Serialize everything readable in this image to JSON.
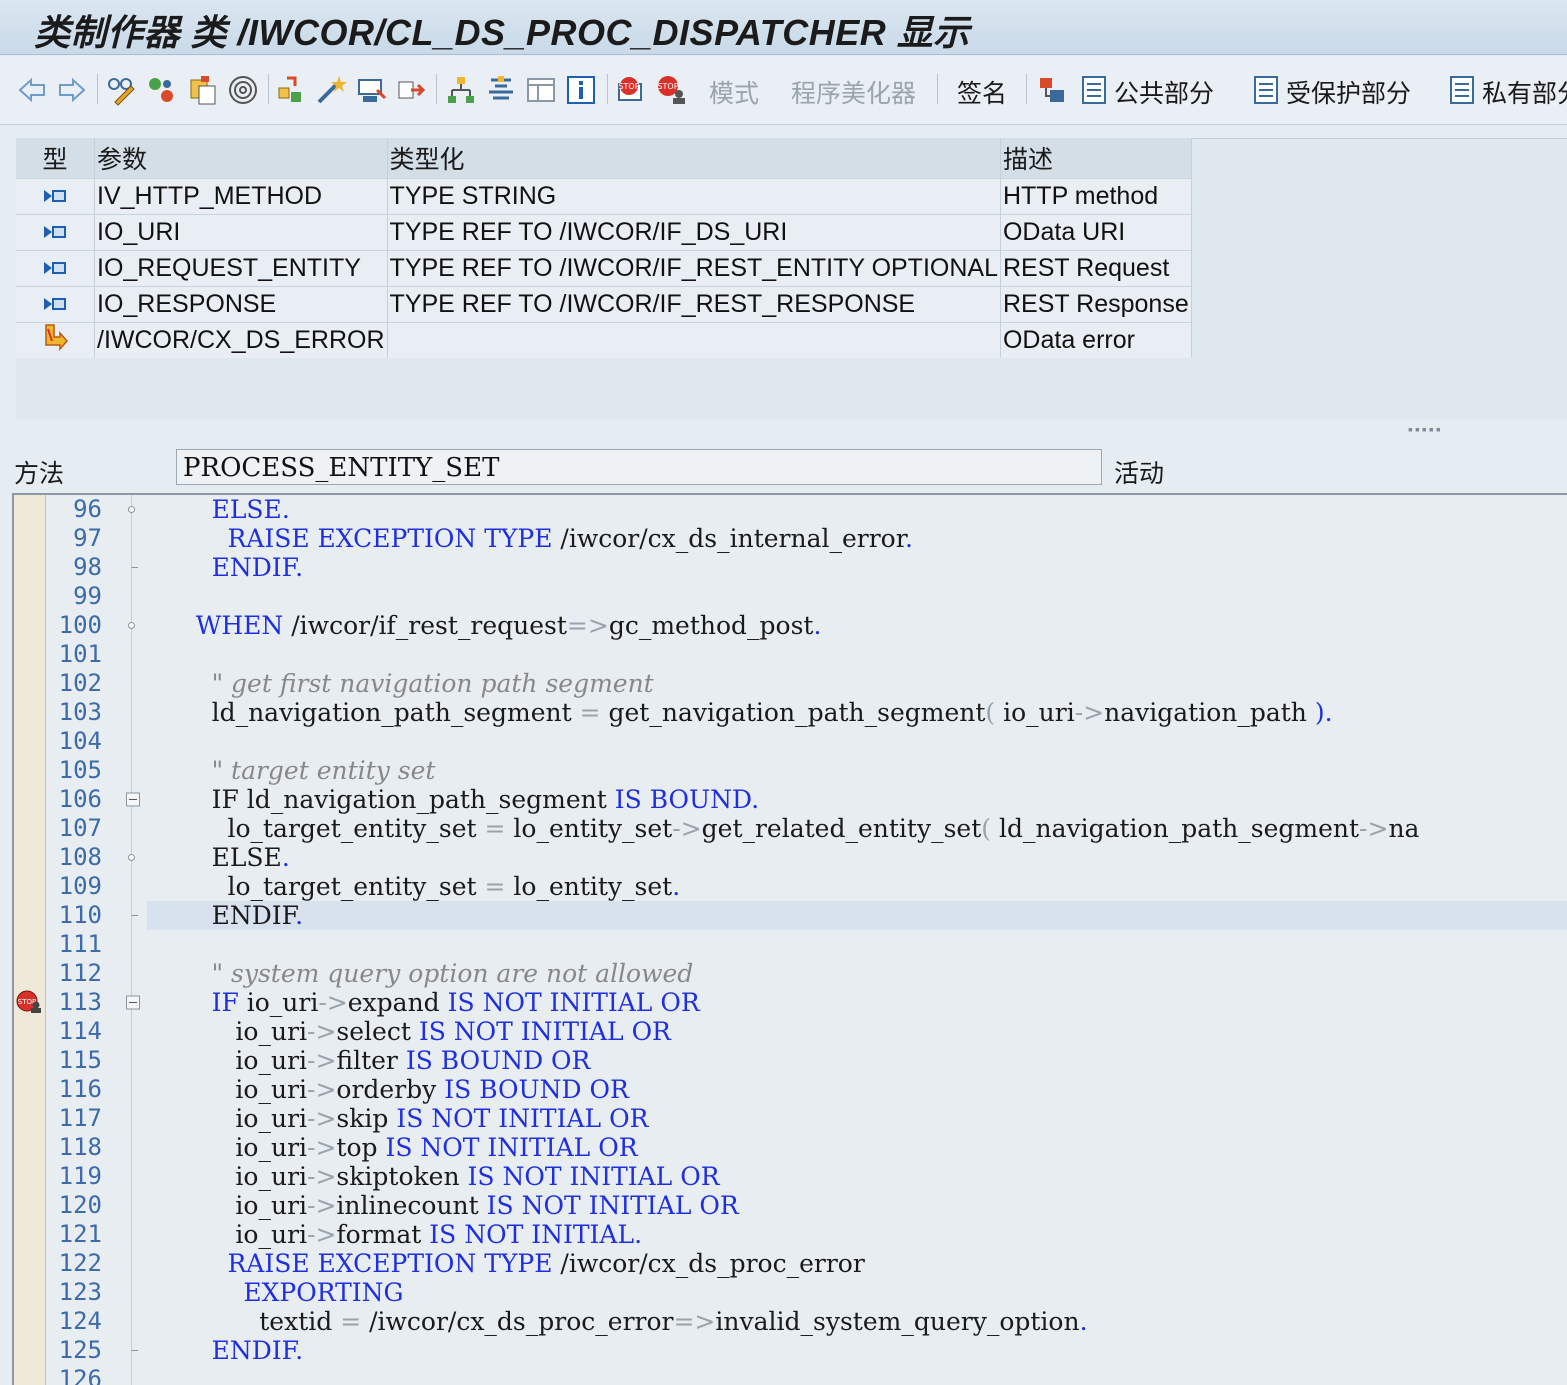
{
  "window": {
    "title": "类制作器 类 /IWCOR/CL_DS_PROC_DISPATCHER 显示"
  },
  "toolbar": {
    "back_icon": "arrow-left-icon",
    "forward_icon": "arrow-right-icon",
    "buttons_text": {
      "mode": "模式",
      "pretty_printer": "程序美化器",
      "signature": "签名",
      "public_section": "公共部分",
      "protected_section": "受保护部分",
      "private_section": "私有部分"
    }
  },
  "params": {
    "headers": {
      "type": "型",
      "param": "参数",
      "typing": "类型化",
      "desc": "描述"
    },
    "rows": [
      {
        "icon": "importing-param-icon",
        "param": "IV_HTTP_METHOD",
        "typing": "TYPE STRING",
        "desc": "HTTP method"
      },
      {
        "icon": "importing-param-icon",
        "param": "IO_URI",
        "typing": "TYPE REF TO /IWCOR/IF_DS_URI",
        "desc": "OData URI"
      },
      {
        "icon": "importing-param-icon",
        "param": "IO_REQUEST_ENTITY",
        "typing": "TYPE REF TO /IWCOR/IF_REST_ENTITY OPTIONAL",
        "desc": "REST Request"
      },
      {
        "icon": "importing-param-icon",
        "param": "IO_RESPONSE",
        "typing": "TYPE REF TO /IWCOR/IF_REST_RESPONSE",
        "desc": "REST Response"
      },
      {
        "icon": "exception-icon",
        "param": "/IWCOR/CX_DS_ERROR",
        "typing": "",
        "desc": "OData error"
      }
    ]
  },
  "method": {
    "label": "方法",
    "name": "PROCESS_ENTITY_SET",
    "status": "活动"
  },
  "colors": {
    "keyword": "#1f2fe0",
    "comment": "#888888",
    "line_number": "#3d6aa9",
    "current_line": "#d7e2ee"
  },
  "code": {
    "current_line": 110,
    "breakpoint_line": 113,
    "lines": [
      {
        "n": "96",
        "fold": "dot",
        "html": "        <span class=\"kw\">ELSE</span><span class=\"pu\">.</span>"
      },
      {
        "n": "97",
        "fold": "",
        "html": "          <span class=\"kw\">RAISE EXCEPTION TYPE</span> /iwcor/cx_ds_internal_error<span class=\"pu\">.</span>"
      },
      {
        "n": "98",
        "fold": "end",
        "html": "        <span class=\"kw\">ENDIF</span><span class=\"pu\">.</span>"
      },
      {
        "n": "99",
        "fold": "",
        "html": ""
      },
      {
        "n": "100",
        "fold": "dot",
        "html": "      <span class=\"kw\">WHEN</span> /iwcor/if_rest_request<span class=\"op\">=&gt;</span>gc_method_post<span class=\"pu\">.</span>"
      },
      {
        "n": "101",
        "fold": "",
        "html": ""
      },
      {
        "n": "102",
        "fold": "",
        "html": "        <span class=\"cm\">\" get first navigation path segment</span>"
      },
      {
        "n": "103",
        "fold": "",
        "html": "        ld_navigation_path_segment <span class=\"op\">=</span> get_navigation_path_segment<span class=\"op\">(</span> io_uri<span class=\"op\">-&gt;</span>navigation_path <span class=\"pu\">).</span>"
      },
      {
        "n": "104",
        "fold": "",
        "html": ""
      },
      {
        "n": "105",
        "fold": "",
        "html": "        <span class=\"cm\">\" target entity set</span>"
      },
      {
        "n": "106",
        "fold": "box",
        "html": "        IF ld_navigation_path_segment <span class=\"kw\">IS BOUND</span><span class=\"pu\">.</span>"
      },
      {
        "n": "107",
        "fold": "",
        "html": "          lo_target_entity_set <span class=\"op\">=</span> lo_entity_set<span class=\"op\">-&gt;</span>get_related_entity_set<span class=\"op\">(</span> ld_navigation_path_segment<span class=\"op\">-&gt;</span>na"
      },
      {
        "n": "108",
        "fold": "dot",
        "html": "        ELSE<span class=\"pu\">.</span>"
      },
      {
        "n": "109",
        "fold": "",
        "html": "          lo_target_entity_set <span class=\"op\">=</span> lo_entity_set<span class=\"pu\">.</span>"
      },
      {
        "n": "110",
        "fold": "end",
        "html": "        ENDIF<span class=\"pu\">.</span>"
      },
      {
        "n": "111",
        "fold": "",
        "html": ""
      },
      {
        "n": "112",
        "fold": "",
        "html": "        <span class=\"cm\">\" system query option are not allowed</span>"
      },
      {
        "n": "113",
        "fold": "box",
        "html": "        <span class=\"kw\">IF</span> io_uri<span class=\"op\">-&gt;</span>expand <span class=\"kw\">IS NOT INITIAL OR</span>"
      },
      {
        "n": "114",
        "fold": "",
        "html": "           io_uri<span class=\"op\">-&gt;</span>select <span class=\"kw\">IS NOT INITIAL OR</span>"
      },
      {
        "n": "115",
        "fold": "",
        "html": "           io_uri<span class=\"op\">-&gt;</span>filter <span class=\"kw\">IS BOUND OR</span>"
      },
      {
        "n": "116",
        "fold": "",
        "html": "           io_uri<span class=\"op\">-&gt;</span>orderby <span class=\"kw\">IS BOUND OR</span>"
      },
      {
        "n": "117",
        "fold": "",
        "html": "           io_uri<span class=\"op\">-&gt;</span>skip <span class=\"kw\">IS NOT INITIAL OR</span>"
      },
      {
        "n": "118",
        "fold": "",
        "html": "           io_uri<span class=\"op\">-&gt;</span>top <span class=\"kw\">IS NOT INITIAL OR</span>"
      },
      {
        "n": "119",
        "fold": "",
        "html": "           io_uri<span class=\"op\">-&gt;</span>skiptoken <span class=\"kw\">IS NOT INITIAL OR</span>"
      },
      {
        "n": "120",
        "fold": "",
        "html": "           io_uri<span class=\"op\">-&gt;</span>inlinecount <span class=\"kw\">IS NOT INITIAL OR</span>"
      },
      {
        "n": "121",
        "fold": "",
        "html": "           io_uri<span class=\"op\">-&gt;</span>format <span class=\"kw\">IS NOT INITIAL</span><span class=\"pu\">.</span>"
      },
      {
        "n": "122",
        "fold": "",
        "html": "          <span class=\"kw\">RAISE EXCEPTION TYPE</span> /iwcor/cx_ds_proc_error"
      },
      {
        "n": "123",
        "fold": "",
        "html": "            <span class=\"kw\">EXPORTING</span>"
      },
      {
        "n": "124",
        "fold": "",
        "html": "              textid <span class=\"op\">=</span> /iwcor/cx_ds_proc_error<span class=\"op\">=&gt;</span>invalid_system_query_option<span class=\"pu\">.</span>"
      },
      {
        "n": "125",
        "fold": "end",
        "html": "        <span class=\"kw\">ENDIF</span><span class=\"pu\">.</span>"
      },
      {
        "n": "126",
        "fold": "",
        "html": ""
      }
    ]
  }
}
